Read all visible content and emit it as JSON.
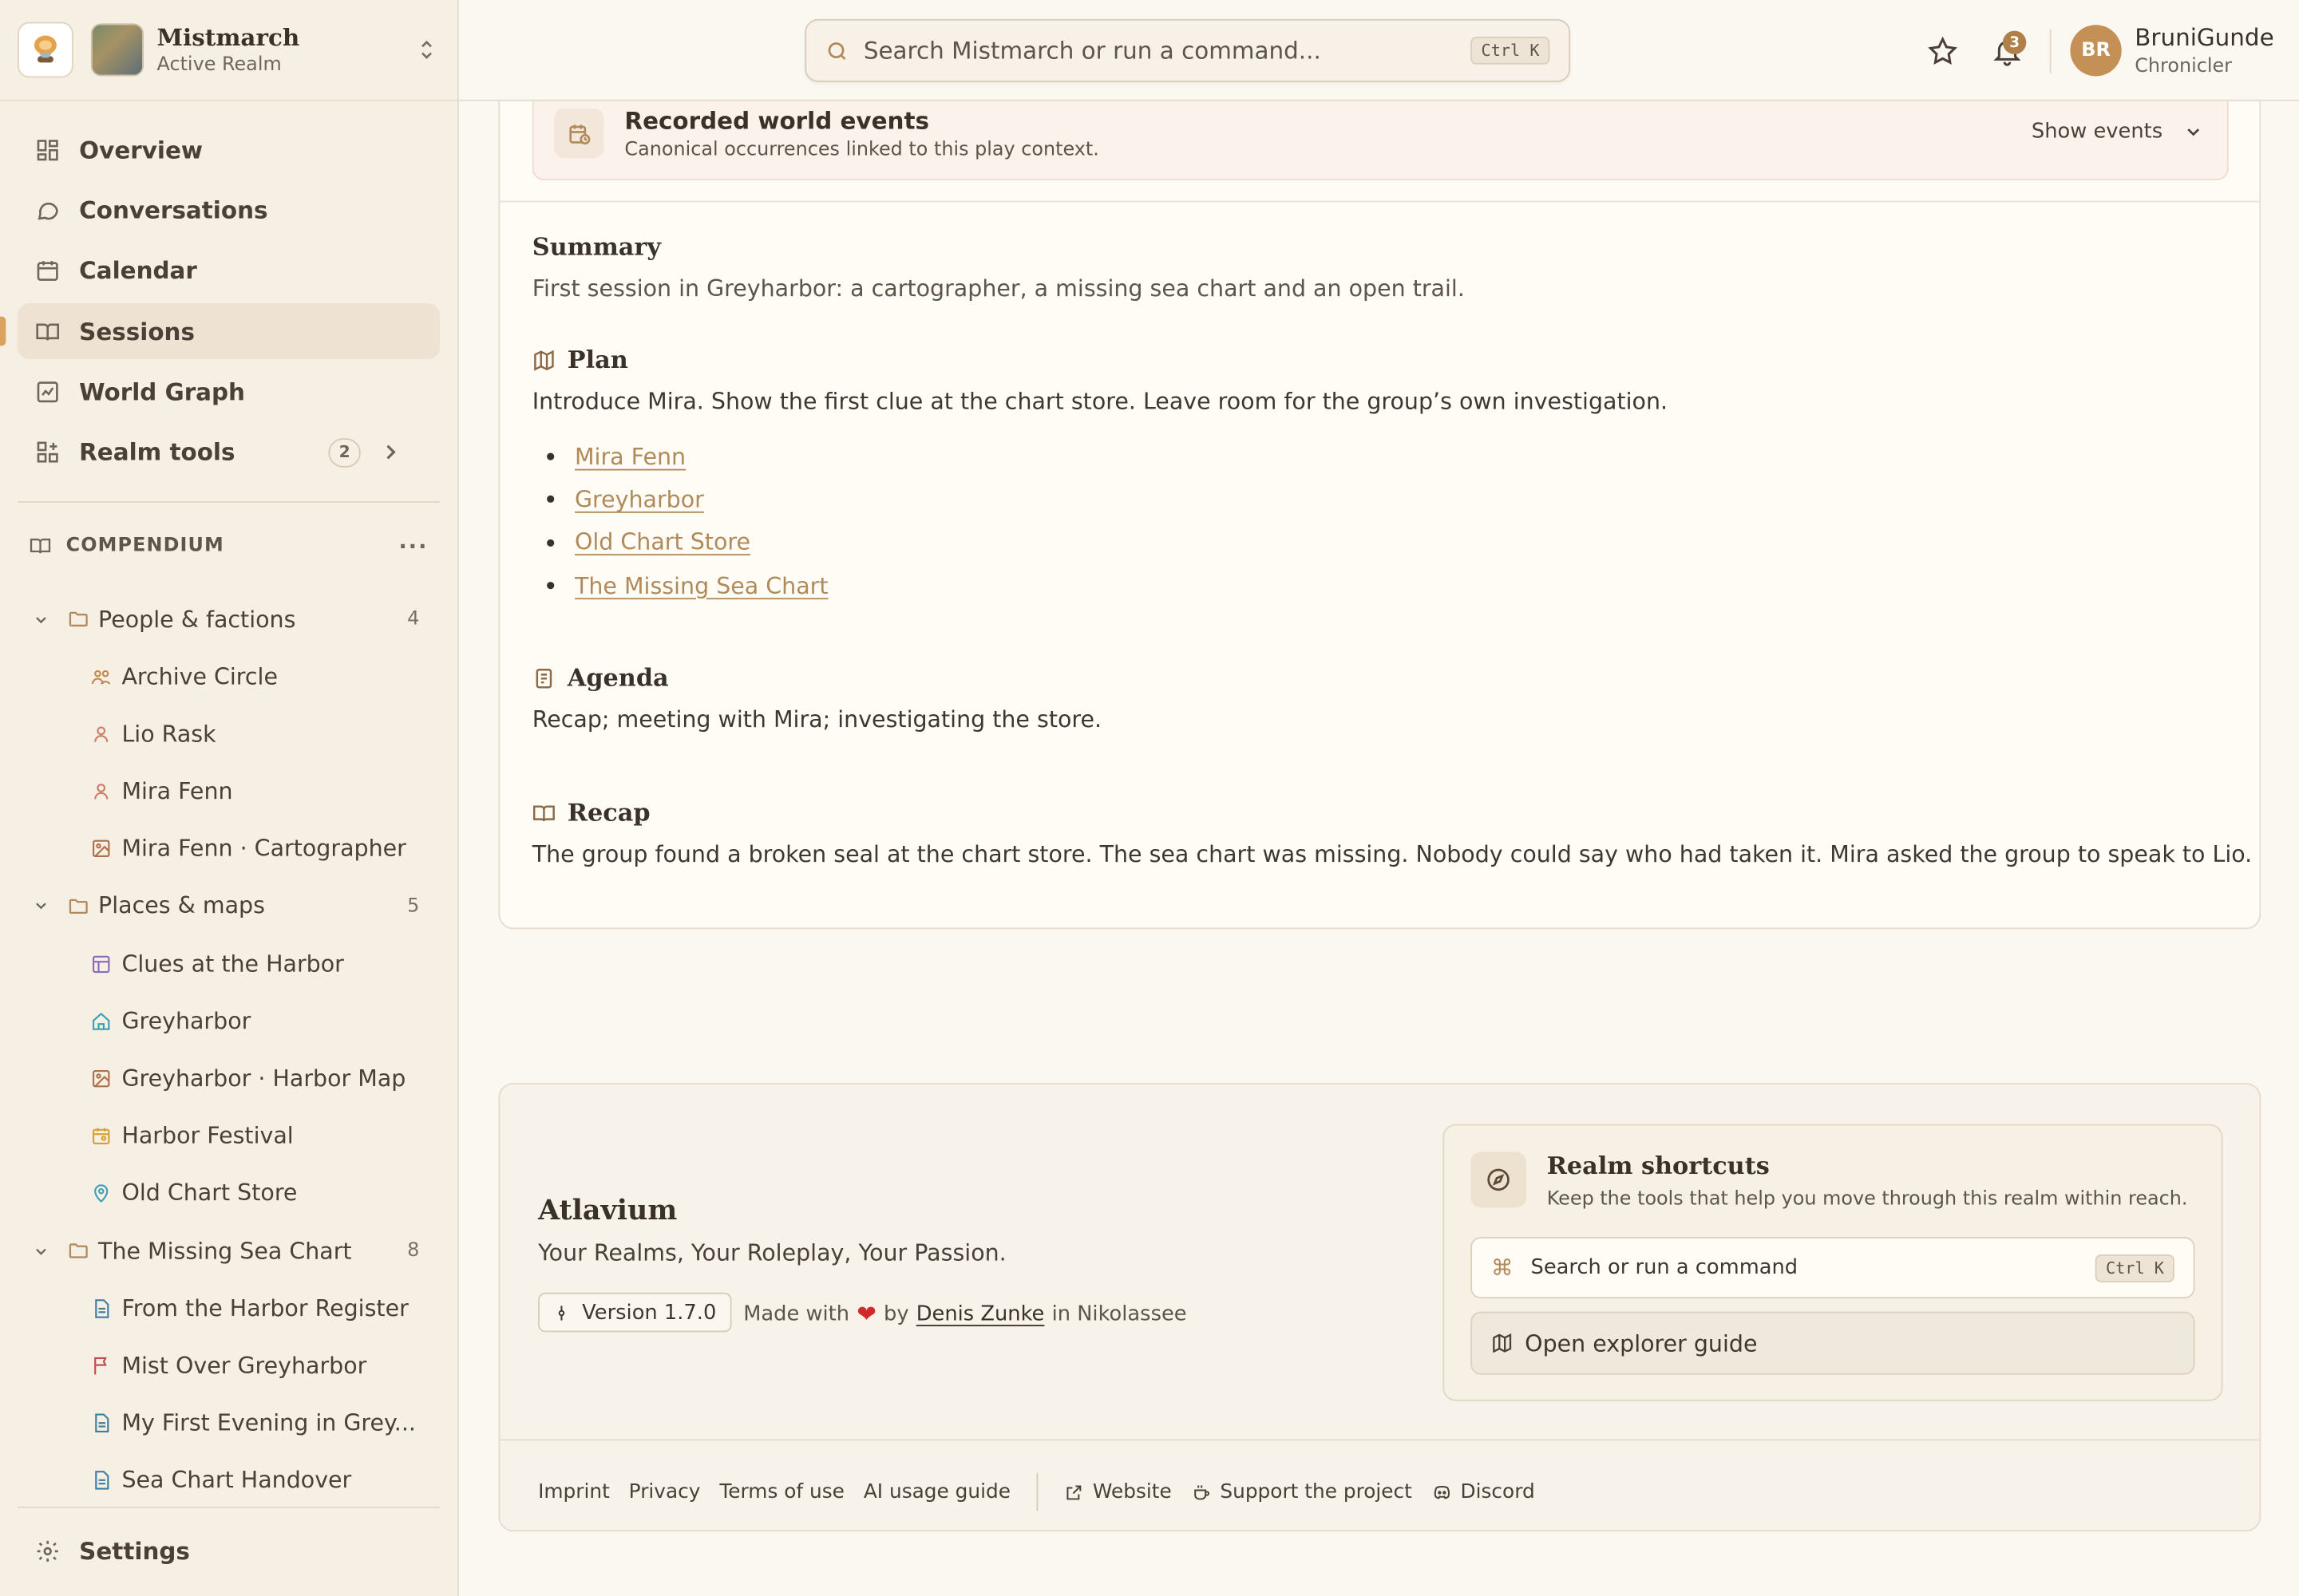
{
  "realm": {
    "name": "Mistmarch",
    "subtitle": "Active Realm"
  },
  "nav": {
    "items": [
      {
        "label": "Overview",
        "icon": "grid-icon"
      },
      {
        "label": "Conversations",
        "icon": "chat-icon"
      },
      {
        "label": "Calendar",
        "icon": "calendar-icon"
      },
      {
        "label": "Sessions",
        "icon": "book-icon",
        "active": true
      },
      {
        "label": "World Graph",
        "icon": "graph-icon"
      },
      {
        "label": "Realm tools",
        "icon": "tools-icon",
        "badge": "2"
      }
    ],
    "settings": "Settings"
  },
  "compendium": {
    "title": "COMPENDIUM",
    "more": "···",
    "folders": [
      {
        "name": "People & factions",
        "count": "4",
        "items": [
          "Archive Circle",
          "Lio Rask",
          "Mira Fenn",
          "Mira Fenn · Cartographer"
        ]
      },
      {
        "name": "Places & maps",
        "count": "5",
        "items": [
          "Clues at the Harbor",
          "Greyharbor",
          "Greyharbor · Harbor Map",
          "Harbor Festival",
          "Old Chart Store"
        ]
      },
      {
        "name": "The Missing Sea Chart",
        "count": "8",
        "items": [
          "From the Harbor Register",
          "Mist Over Greyharbor",
          "My First Evening in Grey...",
          "Sea Chart Handover"
        ]
      }
    ]
  },
  "topbar": {
    "search_placeholder": "Search Mistmarch or run a command...",
    "search_shortcut": "Ctrl K",
    "notification_count": "3",
    "user_initials": "BR",
    "user_name": "BruniGunde",
    "user_role": "Chronicler"
  },
  "events": {
    "title": "Recorded world events",
    "subtitle": "Canonical occurrences linked to this play context.",
    "toggle": "Show events"
  },
  "session": {
    "summary_title": "Summary",
    "summary_text": "First session in Greyharbor: a cartographer, a missing sea chart and an open trail.",
    "plan_title": "Plan",
    "plan_text": "Introduce Mira. Show the first clue at the chart store. Leave room for the group’s own investigation.",
    "plan_links": [
      "Mira Fenn",
      "Greyharbor",
      "Old Chart Store",
      "The Missing Sea Chart"
    ],
    "agenda_title": "Agenda",
    "agenda_text": "Recap; meeting with Mira; investigating the store.",
    "recap_title": "Recap",
    "recap_text": "The group found a broken seal at the chart store. The sea chart was missing. Nobody could say who had taken it. Mira asked the group to speak to Lio."
  },
  "footer": {
    "brand": "Atlavium",
    "tagline": "Your Realms, Your Roleplay, Your Passion.",
    "version": "Version 1.7.0",
    "made_prefix": "Made with",
    "made_by": "by",
    "author": "Denis Zunke",
    "made_suffix": "in Nikolassee",
    "shortcuts_title": "Realm shortcuts",
    "shortcuts_subtitle": "Keep the tools that help you move through this realm within reach.",
    "shortcuts_search": "Search or run a command",
    "shortcuts_kbd": "Ctrl K",
    "shortcuts_guide": "Open explorer guide",
    "links": [
      "Imprint",
      "Privacy",
      "Terms of use",
      "AI usage guide"
    ],
    "ext_links": [
      "Website",
      "Support the project",
      "Discord"
    ]
  }
}
